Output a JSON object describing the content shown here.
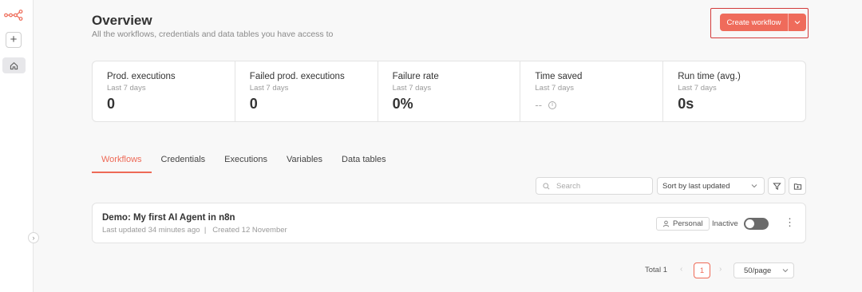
{
  "header": {
    "title": "Overview",
    "subtitle": "All the workflows, credentials and data tables you have access to",
    "create_label": "Create workflow"
  },
  "sidebar": {
    "add_label": "+",
    "expand_label": "›",
    "icons": [
      "n8n-logo-icon",
      "plus-icon",
      "home-icon",
      "chevron-right-icon"
    ]
  },
  "stats": [
    {
      "label": "Prod. executions",
      "period": "Last 7 days",
      "value": "0"
    },
    {
      "label": "Failed prod. executions",
      "period": "Last 7 days",
      "value": "0"
    },
    {
      "label": "Failure rate",
      "period": "Last 7 days",
      "value": "0%"
    },
    {
      "label": "Time saved",
      "period": "Last 7 days",
      "value": "--"
    },
    {
      "label": "Run time (avg.)",
      "period": "Last 7 days",
      "value": "0s"
    }
  ],
  "tabs": [
    {
      "label": "Workflows",
      "active": true
    },
    {
      "label": "Credentials"
    },
    {
      "label": "Executions"
    },
    {
      "label": "Variables"
    },
    {
      "label": "Data tables"
    }
  ],
  "toolbar": {
    "search_placeholder": "Search",
    "sort_value": "Sort by last updated"
  },
  "workflow": {
    "name": "Demo: My first AI Agent in n8n",
    "updated": "Last updated 34 minutes ago",
    "created": "Created 12 November",
    "owner": "Personal",
    "status": "Inactive",
    "active": false
  },
  "pagination": {
    "total": "Total 1",
    "current": "1",
    "page_size": "50/page"
  },
  "colors": {
    "accent": "#ee6a57",
    "highlight_outline": "#d33b3b"
  }
}
